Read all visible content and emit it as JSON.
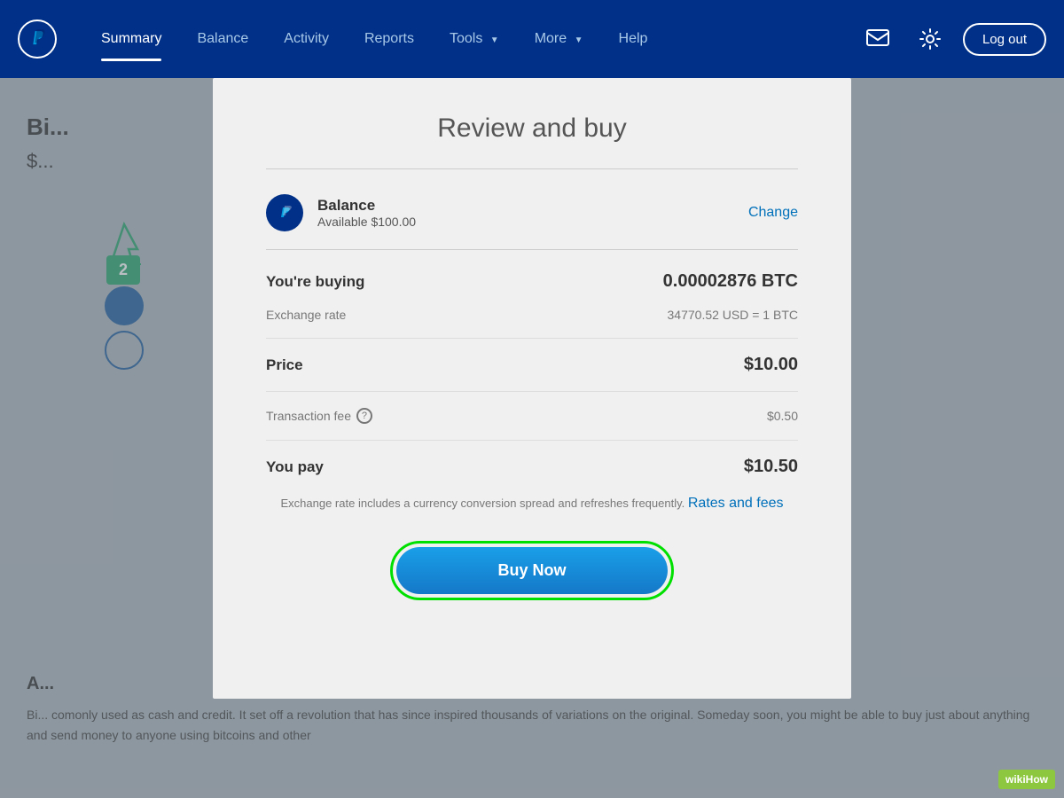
{
  "header": {
    "nav": [
      {
        "label": "Summary",
        "active": true
      },
      {
        "label": "Balance",
        "active": false
      },
      {
        "label": "Activity",
        "active": false
      },
      {
        "label": "Reports",
        "active": false
      },
      {
        "label": "Tools",
        "active": false,
        "hasArrow": true
      },
      {
        "label": "More",
        "active": false,
        "hasArrow": true
      },
      {
        "label": "Help",
        "active": false
      }
    ],
    "logout_label": "Log out"
  },
  "background": {
    "title_partial": "Bi...",
    "price_partial": "$...",
    "badge_text": "2",
    "section_title": "A...",
    "body_text": "Bi... comonly used as cash and credit. It set off a revolution that has since inspired thousands of variations on the original. Someday soon, you might be able to buy just about anything and send money to anyone using bitcoins and other"
  },
  "modal": {
    "title": "Review and buy",
    "payment": {
      "label": "Balance",
      "available": "Available $100.00",
      "change_link": "Change"
    },
    "buying_label": "You're buying",
    "buying_value": "0.00002876 BTC",
    "exchange_rate_label": "Exchange rate",
    "exchange_rate_value": "34770.52 USD = 1 BTC",
    "price_label": "Price",
    "price_value": "$10.00",
    "transaction_fee_label": "Transaction fee",
    "transaction_fee_help": "?",
    "transaction_fee_value": "$0.50",
    "you_pay_label": "You pay",
    "you_pay_value": "$10.50",
    "exchange_note_text": "Exchange rate includes a currency conversion spread and refreshes frequently.",
    "rates_fees_link": "Rates and fees",
    "buy_now_label": "Buy Now"
  },
  "wikihow": {
    "label": "wikiHow"
  }
}
